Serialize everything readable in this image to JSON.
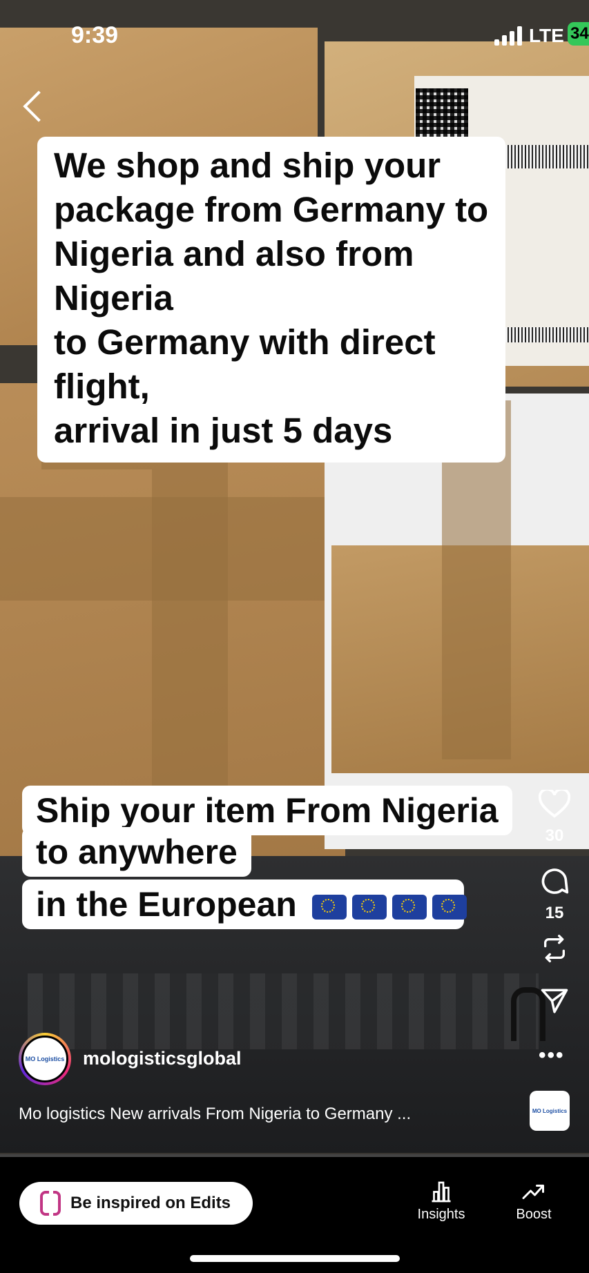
{
  "status_bar": {
    "time": "9:39",
    "network": "LTE",
    "battery": "34"
  },
  "overlay_text_top": [
    "We shop and ship your",
    "package from Germany to",
    "Nigeria and also from Nigeria",
    "to Germany with direct flight,",
    "arrival in just 5 days"
  ],
  "overlay_text_bottom": {
    "line1": "Ship your  item From Nigeria",
    "line2": "to anywhere",
    "line3": "in the European"
  },
  "actions": {
    "like_count": "30",
    "comment_count": "15"
  },
  "author": {
    "username": "mologisticsglobal",
    "avatar_text": "MO Logistics"
  },
  "caption": "Mo logistics New arrivals From Nigeria to Germany ...",
  "audio_thumb_text": "MO Logistics",
  "bottom_bar": {
    "edits_label": "Be inspired on Edits",
    "insights_label": "Insights",
    "boost_label": "Boost"
  },
  "colors": {
    "accent_battery": "#34c759",
    "sticker_bg": "#ffffff",
    "text": "#0b0b0b"
  }
}
